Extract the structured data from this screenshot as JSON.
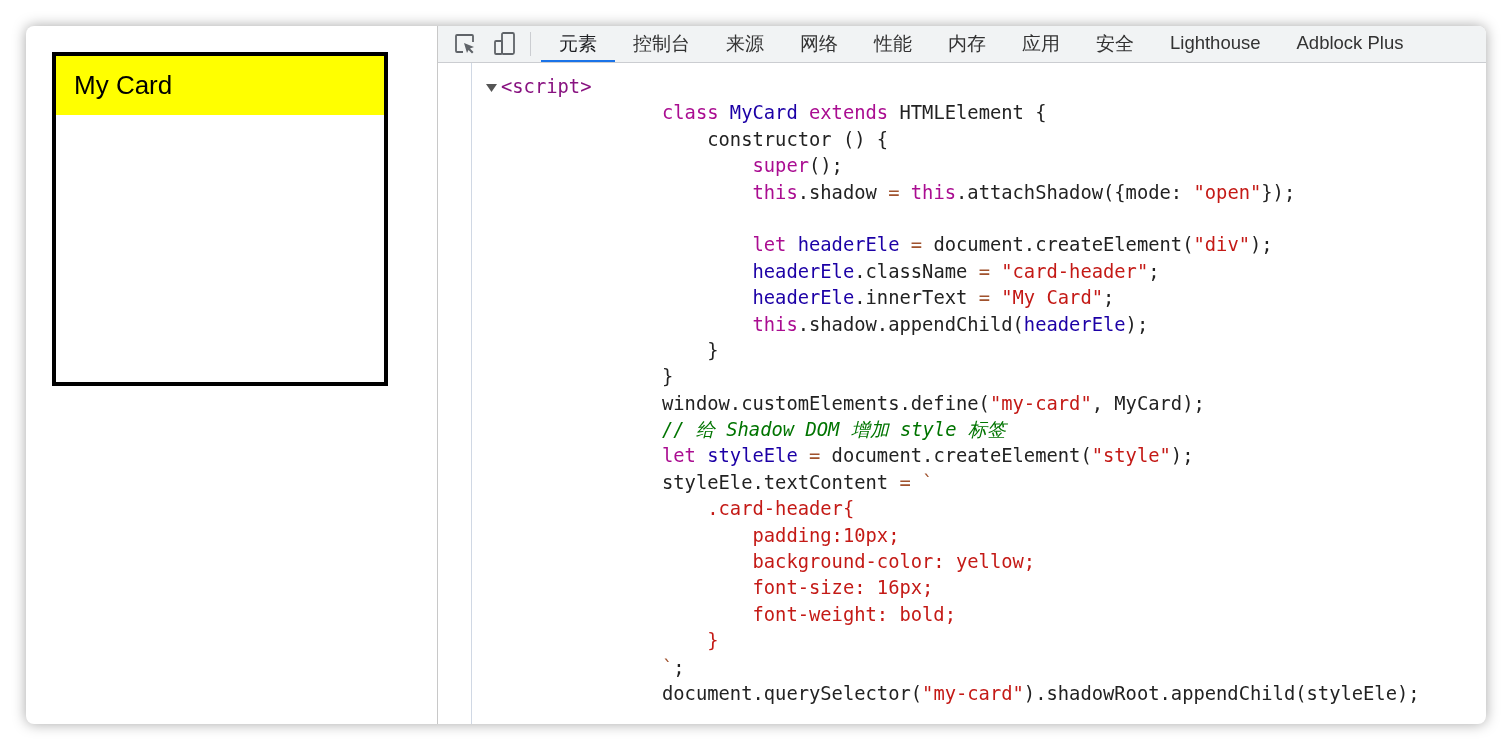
{
  "preview": {
    "card_title": "My Card"
  },
  "devtools": {
    "tabs": [
      {
        "label": "元素",
        "selected": true
      },
      {
        "label": "控制台",
        "selected": false
      },
      {
        "label": "来源",
        "selected": false
      },
      {
        "label": "网络",
        "selected": false
      },
      {
        "label": "性能",
        "selected": false
      },
      {
        "label": "内存",
        "selected": false
      },
      {
        "label": "应用",
        "selected": false
      },
      {
        "label": "安全",
        "selected": false
      },
      {
        "label": "Lighthouse",
        "selected": false
      },
      {
        "label": "Adblock Plus",
        "selected": false
      }
    ],
    "element_tree": {
      "tag": "<script>",
      "expanded": true,
      "code_lines": [
        {
          "kind": "code",
          "tokens": [
            {
              "kind": "keyword",
              "text": "class"
            },
            {
              "kind": "name",
              "text": " MyCard"
            },
            {
              "kind": "keyword",
              "text": " extends"
            },
            {
              "kind": "plain",
              "text": " HTMLElement {"
            }
          ]
        },
        {
          "kind": "code",
          "tokens": [
            {
              "kind": "plain",
              "text": "    constructor () {"
            }
          ]
        },
        {
          "kind": "code",
          "tokens": [
            {
              "kind": "keyword",
              "text": "        super"
            },
            {
              "kind": "plain",
              "text": "();"
            }
          ]
        },
        {
          "kind": "code",
          "tokens": [
            {
              "kind": "keyword",
              "text": "        this"
            },
            {
              "kind": "plain",
              "text": ".shadow "
            },
            {
              "kind": "operator",
              "text": "="
            },
            {
              "kind": "keyword",
              "text": " this"
            },
            {
              "kind": "plain",
              "text": ".attachShadow({mode: "
            },
            {
              "kind": "string",
              "text": "\"open\""
            },
            {
              "kind": "plain",
              "text": "});"
            }
          ]
        },
        {
          "kind": "blank"
        },
        {
          "kind": "code",
          "tokens": [
            {
              "kind": "keyword",
              "text": "        let"
            },
            {
              "kind": "name",
              "text": " headerEle "
            },
            {
              "kind": "operator",
              "text": "="
            },
            {
              "kind": "plain",
              "text": " document.createElement("
            },
            {
              "kind": "string",
              "text": "\"div\""
            },
            {
              "kind": "plain",
              "text": ");"
            }
          ]
        },
        {
          "kind": "code",
          "tokens": [
            {
              "kind": "name",
              "text": "        headerEle"
            },
            {
              "kind": "plain",
              "text": ".className "
            },
            {
              "kind": "operator",
              "text": "="
            },
            {
              "kind": "string",
              "text": " \"card-header\""
            },
            {
              "kind": "plain",
              "text": ";"
            }
          ]
        },
        {
          "kind": "code",
          "tokens": [
            {
              "kind": "name",
              "text": "        headerEle"
            },
            {
              "kind": "plain",
              "text": ".innerText "
            },
            {
              "kind": "operator",
              "text": "="
            },
            {
              "kind": "string",
              "text": " \"My Card\""
            },
            {
              "kind": "plain",
              "text": ";"
            }
          ]
        },
        {
          "kind": "code",
          "tokens": [
            {
              "kind": "keyword",
              "text": "        this"
            },
            {
              "kind": "plain",
              "text": ".shadow.appendChild("
            },
            {
              "kind": "name",
              "text": "headerEle"
            },
            {
              "kind": "plain",
              "text": ");"
            }
          ]
        },
        {
          "kind": "code",
          "tokens": [
            {
              "kind": "plain",
              "text": "    }"
            }
          ]
        },
        {
          "kind": "code",
          "tokens": [
            {
              "kind": "plain",
              "text": "}"
            }
          ]
        },
        {
          "kind": "code",
          "tokens": [
            {
              "kind": "plain",
              "text": "window.customElements.define("
            },
            {
              "kind": "string",
              "text": "\"my-card\""
            },
            {
              "kind": "plain",
              "text": ", MyCard);"
            }
          ]
        },
        {
          "kind": "code",
          "tokens": [
            {
              "kind": "comment",
              "text": "// 给 Shadow DOM 增加 style 标签"
            }
          ]
        },
        {
          "kind": "code",
          "tokens": [
            {
              "kind": "keyword",
              "text": "let"
            },
            {
              "kind": "name",
              "text": " styleEle "
            },
            {
              "kind": "operator",
              "text": "="
            },
            {
              "kind": "plain",
              "text": " document.createElement("
            },
            {
              "kind": "string",
              "text": "\"style\""
            },
            {
              "kind": "plain",
              "text": ");"
            }
          ]
        },
        {
          "kind": "code",
          "tokens": [
            {
              "kind": "plain",
              "text": "styleEle.textContent "
            },
            {
              "kind": "operator",
              "text": "= `"
            }
          ]
        },
        {
          "kind": "code",
          "tokens": [
            {
              "kind": "string",
              "text": "    .card-header{"
            }
          ]
        },
        {
          "kind": "code",
          "tokens": [
            {
              "kind": "string",
              "text": "        padding:10px;"
            }
          ]
        },
        {
          "kind": "code",
          "tokens": [
            {
              "kind": "string",
              "text": "        background-color: yellow;"
            }
          ]
        },
        {
          "kind": "code",
          "tokens": [
            {
              "kind": "string",
              "text": "        font-size: 16px;"
            }
          ]
        },
        {
          "kind": "code",
          "tokens": [
            {
              "kind": "string",
              "text": "        font-weight: bold;"
            }
          ]
        },
        {
          "kind": "code",
          "tokens": [
            {
              "kind": "string",
              "text": "    }"
            }
          ]
        },
        {
          "kind": "code",
          "tokens": [
            {
              "kind": "operator",
              "text": "`"
            },
            {
              "kind": "plain",
              "text": ";"
            }
          ]
        },
        {
          "kind": "code",
          "tokens": [
            {
              "kind": "plain",
              "text": "document.querySelector("
            },
            {
              "kind": "string",
              "text": "\"my-card\""
            },
            {
              "kind": "plain",
              "text": ").shadowRoot.appendChild(styleEle);"
            }
          ]
        }
      ]
    }
  }
}
